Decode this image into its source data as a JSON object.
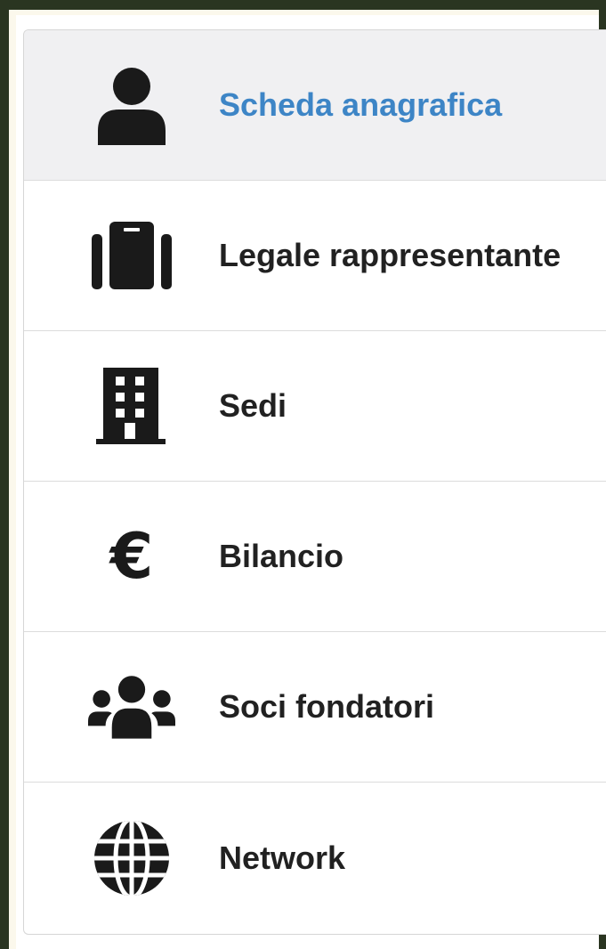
{
  "menu": {
    "items": [
      {
        "label": "Scheda anagrafica",
        "icon": "user-icon",
        "active": true
      },
      {
        "label": "Legale rappresentante",
        "icon": "briefcase-icon",
        "active": false
      },
      {
        "label": "Sedi",
        "icon": "building-icon",
        "active": false
      },
      {
        "label": "Bilancio",
        "icon": "euro-icon",
        "active": false
      },
      {
        "label": "Soci fondatori",
        "icon": "users-icon",
        "active": false
      },
      {
        "label": "Network",
        "icon": "globe-icon",
        "active": false
      }
    ]
  },
  "icons": {
    "euro_glyph": "€"
  },
  "colors": {
    "active_text": "#3d85c6",
    "text": "#212121",
    "active_background": "#f0f0f2",
    "frame": "#2a3521"
  }
}
